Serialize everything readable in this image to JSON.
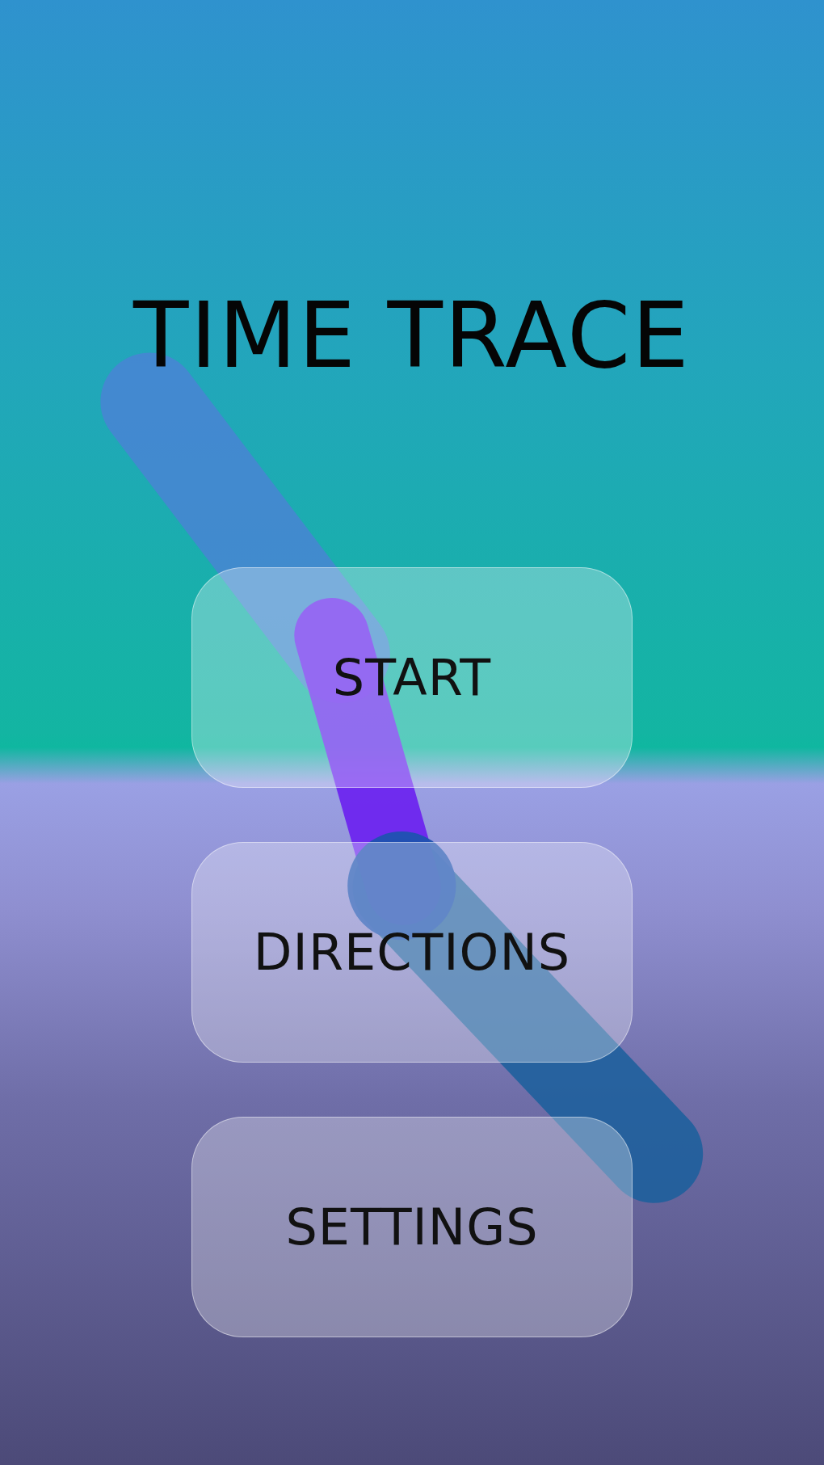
{
  "title": "TIME TRACE",
  "buttons": [
    {
      "label": "START"
    },
    {
      "label": "DIRECTIONS"
    },
    {
      "label": "SETTINGS"
    }
  ]
}
